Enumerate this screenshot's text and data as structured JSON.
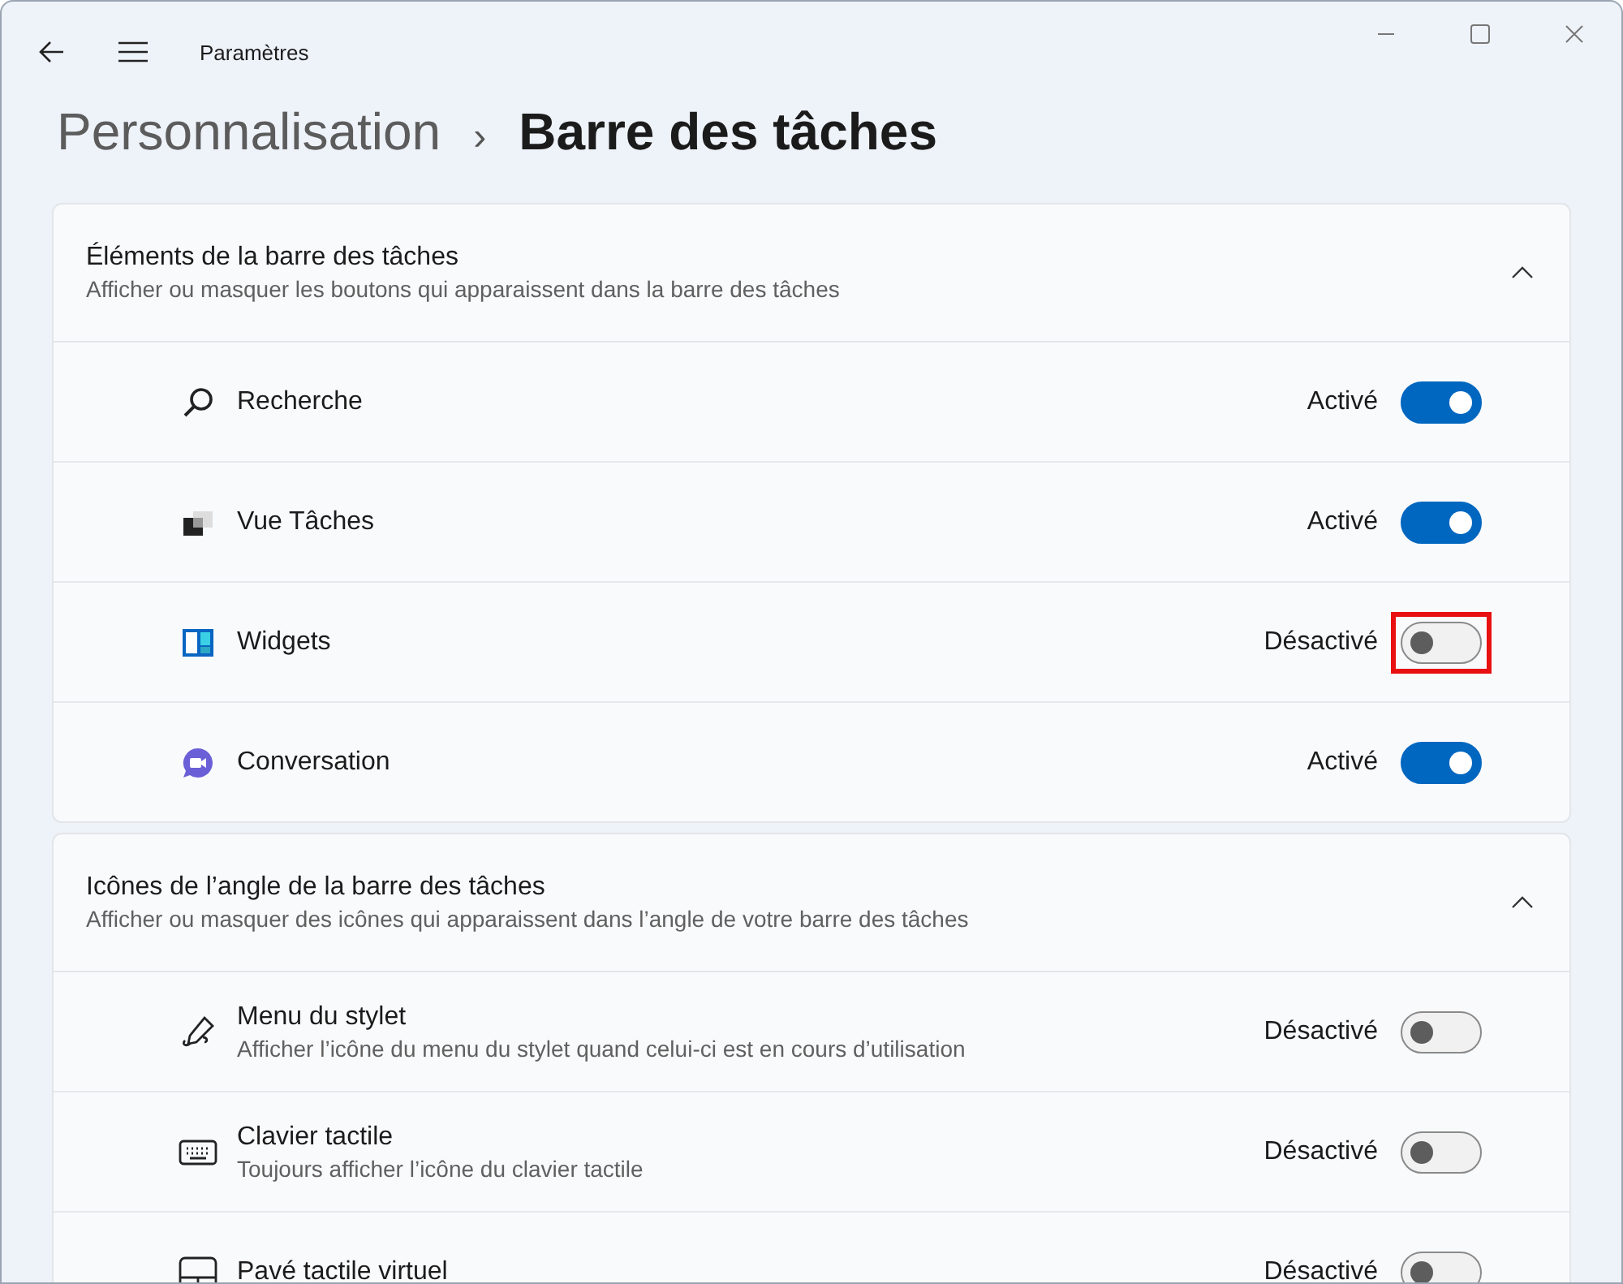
{
  "window": {
    "title": "Paramètres"
  },
  "breadcrumb": {
    "parent": "Personnalisation",
    "separator": "›",
    "current": "Barre des tâches"
  },
  "sections": [
    {
      "title": "Éléments de la barre des tâches",
      "subtitle": "Afficher ou masquer les boutons qui apparaissent dans la barre des tâches",
      "expanded": true,
      "items": [
        {
          "label": "Recherche",
          "status": "Activé",
          "on": true,
          "highlighted": false
        },
        {
          "label": "Vue Tâches",
          "status": "Activé",
          "on": true,
          "highlighted": false
        },
        {
          "label": "Widgets",
          "status": "Désactivé",
          "on": false,
          "highlighted": true
        },
        {
          "label": "Conversation",
          "status": "Activé",
          "on": true,
          "highlighted": false
        }
      ]
    },
    {
      "title": "Icônes de l’angle de la barre des tâches",
      "subtitle": "Afficher ou masquer des icônes qui apparaissent dans l’angle de votre barre des tâches",
      "expanded": true,
      "items": [
        {
          "label": "Menu du stylet",
          "description": "Afficher l’icône du menu du stylet quand celui-ci est en cours d’utilisation",
          "status": "Désactivé",
          "on": false,
          "highlighted": false
        },
        {
          "label": "Clavier tactile",
          "description": "Toujours afficher l’icône du clavier tactile",
          "status": "Désactivé",
          "on": false,
          "highlighted": false
        },
        {
          "label": "Pavé tactile virtuel",
          "status": "Désactivé",
          "on": false,
          "highlighted": false
        }
      ]
    }
  ]
}
